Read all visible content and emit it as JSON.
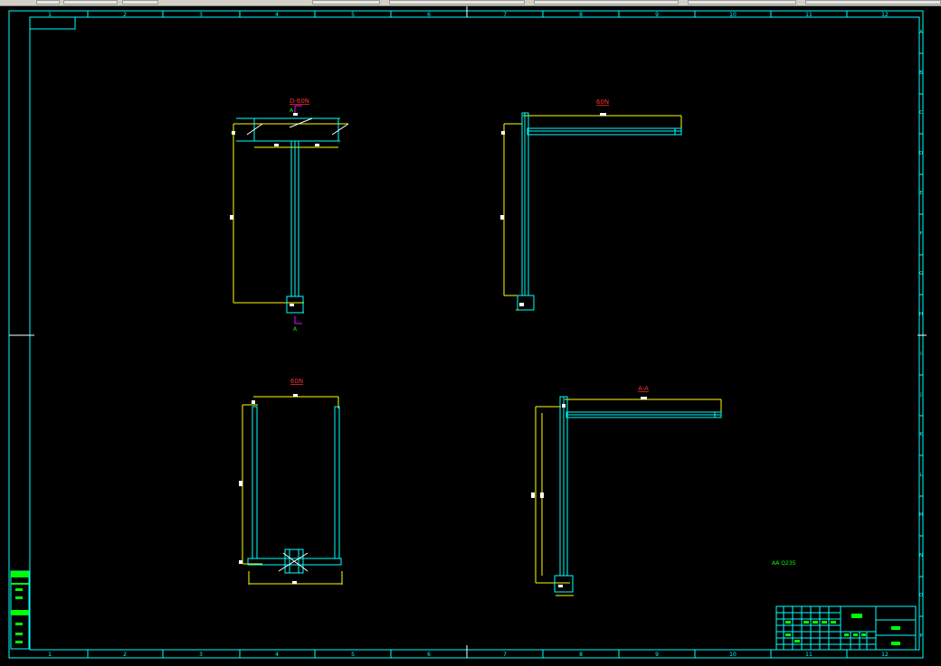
{
  "toolbar": {
    "buttons": [
      "",
      "",
      "",
      "",
      "",
      "",
      "",
      ""
    ]
  },
  "frame": {
    "top_numbers": [
      "1",
      "2",
      "3",
      "4",
      "5",
      "6",
      "7",
      "8",
      "9",
      "10",
      "11",
      "12"
    ],
    "bottom_numbers": [
      "1",
      "2",
      "3",
      "4",
      "5",
      "6",
      "7",
      "8",
      "9",
      "10",
      "11",
      "12"
    ],
    "side_letters": [
      "A",
      "B",
      "C",
      "D",
      "E",
      "F",
      "G",
      "H",
      "I",
      "J",
      "K",
      "L",
      "M",
      "N",
      "O",
      "P"
    ]
  },
  "views": {
    "front": {
      "title": "D-60N",
      "section_mark_top": "A",
      "section_mark_bottom": "A"
    },
    "side": {
      "title": "60N"
    },
    "bottom_left": {
      "title": "60N"
    },
    "section": {
      "title": "A-A"
    }
  },
  "note": "AA Q235",
  "title_block": {
    "name": ""
  },
  "colors": {
    "frame": "#00ffff",
    "dimension": "#ffff00",
    "title_red": "#ff3030",
    "green": "#00ff00",
    "magenta": "#ff00ff",
    "white": "#ffffff"
  }
}
